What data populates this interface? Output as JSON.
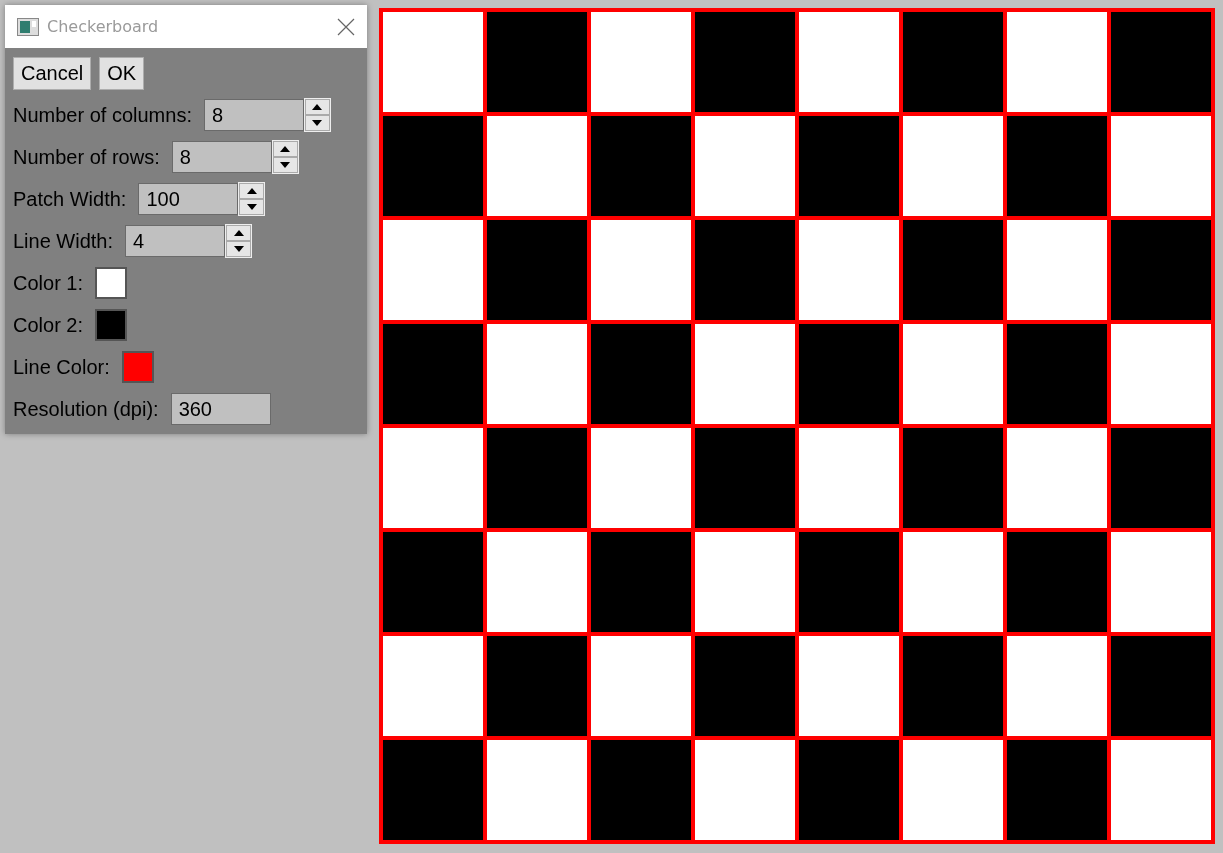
{
  "window": {
    "title": "Checkerboard"
  },
  "buttons": [
    "Cancel",
    "OK"
  ],
  "fields": [
    {
      "kind": "spin",
      "label": "Number of columns:",
      "value": "8"
    },
    {
      "kind": "spin",
      "label": "Number of rows:",
      "value": "8"
    },
    {
      "kind": "spin",
      "label": "Patch Width:",
      "value": "100"
    },
    {
      "kind": "spin",
      "label": "Line Width:",
      "value": "4"
    },
    {
      "kind": "swatch",
      "label": "Color 1:",
      "color": "#ffffff"
    },
    {
      "kind": "swatch",
      "label": "Color 2:",
      "color": "#000000"
    },
    {
      "kind": "swatch",
      "label": "Line Color:",
      "color": "#ff0000"
    },
    {
      "kind": "text",
      "label": "Resolution (dpi):",
      "value": "360"
    }
  ]
}
